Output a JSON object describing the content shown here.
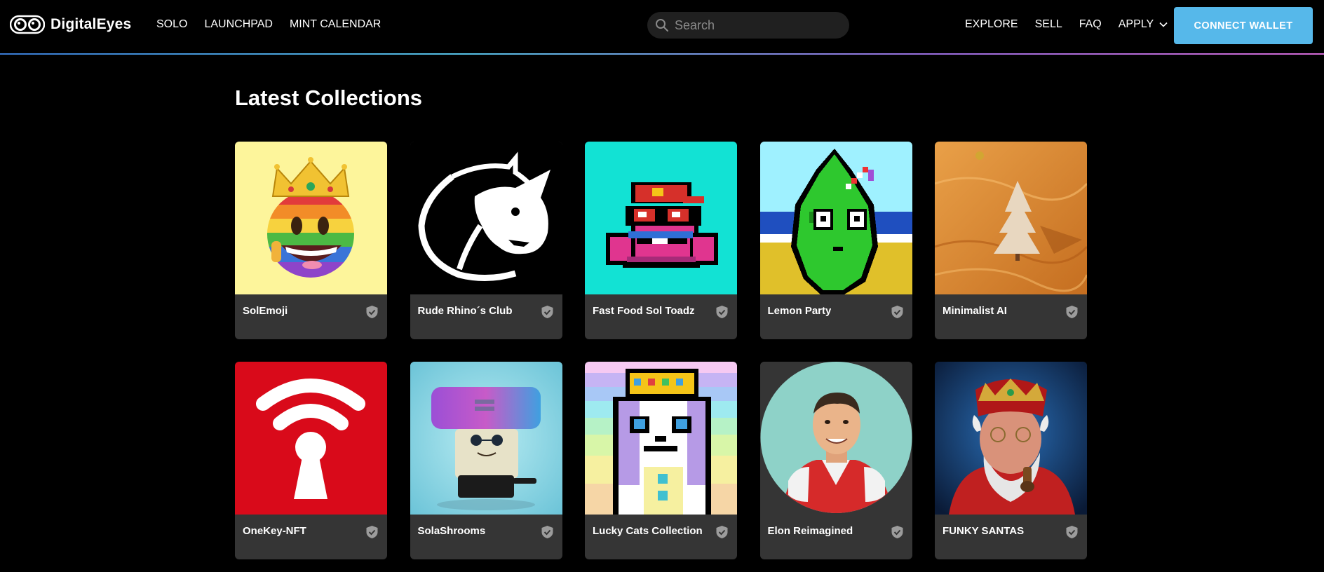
{
  "brand": {
    "name": "DigitalEyes",
    "logo_icon": "eyes-logo-icon"
  },
  "nav": {
    "left_links": [
      "SOLO",
      "LAUNCHPAD",
      "MINT CALENDAR"
    ],
    "search_placeholder": "Search",
    "right_links": [
      "EXPLORE",
      "SELL",
      "FAQ"
    ],
    "apply_label": "APPLY",
    "connect_wallet": "CONNECT WALLET"
  },
  "colors": {
    "accent": "#56b8ea",
    "card_bg": "#353535",
    "background": "#000000"
  },
  "section": {
    "title": "Latest Collections"
  },
  "collections": [
    {
      "name": "SolEmoji",
      "art": "crowned-rainbow-emoji",
      "verified": true
    },
    {
      "name": "Rude Rhino´s Club",
      "art": "rhino-logo",
      "verified": true
    },
    {
      "name": "Fast Food Sol Toadz",
      "art": "pixel-toad",
      "verified": true
    },
    {
      "name": "Lemon Party",
      "art": "pixel-lemon",
      "verified": true
    },
    {
      "name": "Minimalist AI",
      "art": "desert-tree",
      "verified": true
    },
    {
      "name": "OneKey-NFT",
      "art": "wifi-keyhole",
      "verified": true
    },
    {
      "name": "SolaShrooms",
      "art": "mushroom-character",
      "verified": true
    },
    {
      "name": "Lucky Cats Collection",
      "art": "pixel-cat",
      "verified": true
    },
    {
      "name": "Elon Reimagined",
      "art": "portrait-circle",
      "verified": true
    },
    {
      "name": "FUNKY SANTAS",
      "art": "santa-portrait",
      "verified": true
    }
  ]
}
